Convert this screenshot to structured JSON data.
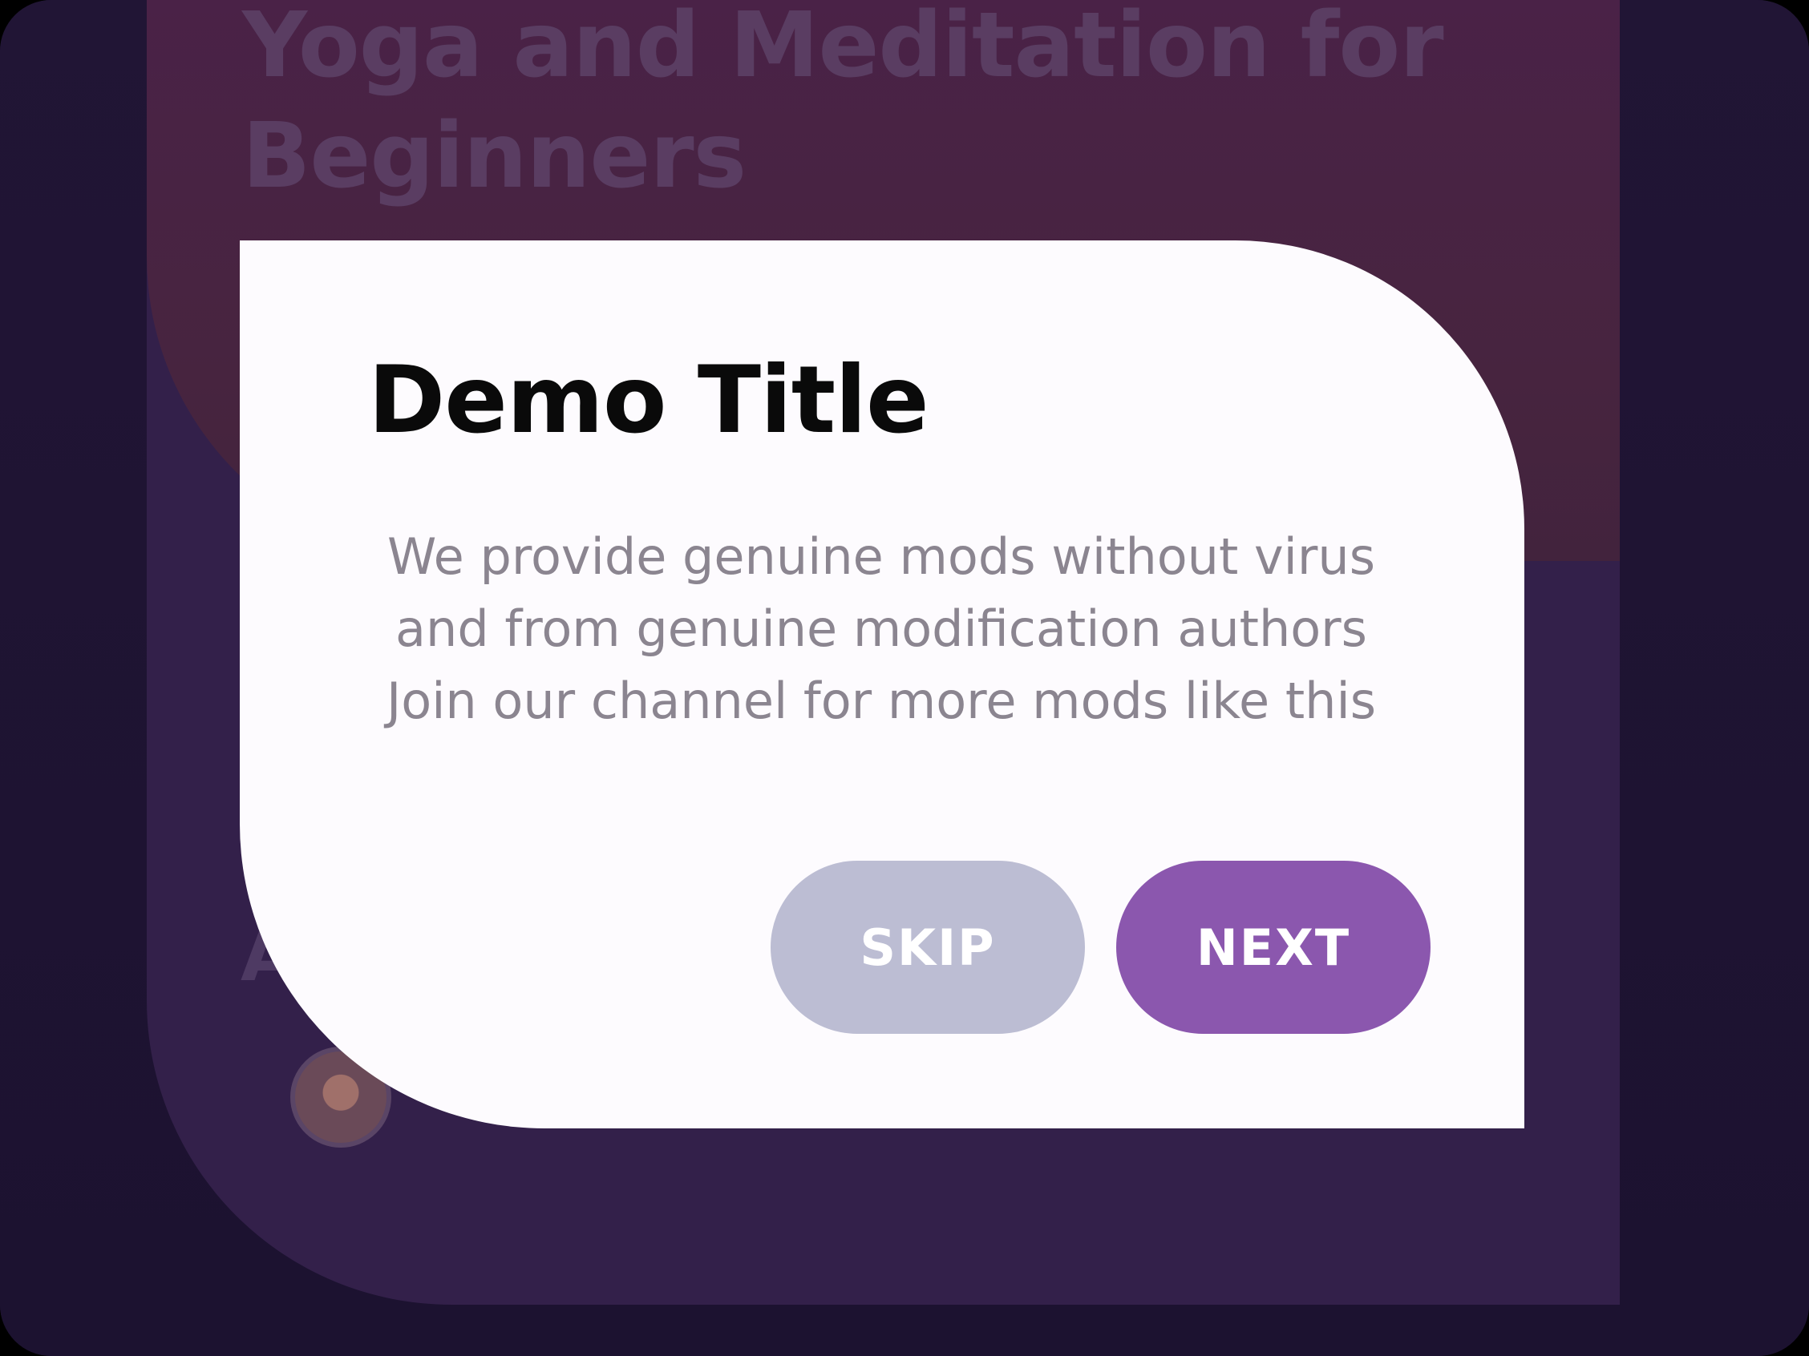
{
  "background": {
    "title": "Yoga and Meditation for Beginners",
    "partial_heading_letter": "A"
  },
  "dialog": {
    "title": "Demo Title",
    "body_lines": [
      "We provide genuine mods without virus",
      "and from genuine modification authors",
      "Join our channel for more mods like this"
    ],
    "skip_label": "SKIP",
    "next_label": "NEXT"
  },
  "colors": {
    "dialog_background": "#fdfbfe",
    "next_button": "#8b57ae",
    "skip_button": "#bcbdd3",
    "overlay_dark": "#1b1230"
  }
}
